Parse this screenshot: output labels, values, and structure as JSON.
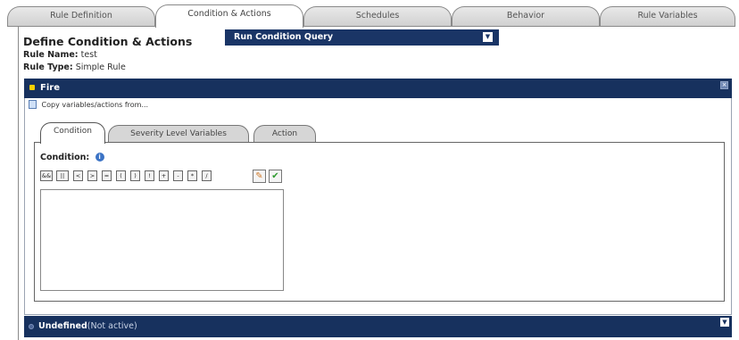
{
  "top_tabs": [
    {
      "label": "Rule Definition"
    },
    {
      "label": "Condition & Actions"
    },
    {
      "label": "Schedules"
    },
    {
      "label": "Behavior"
    },
    {
      "label": "Rule Variables"
    }
  ],
  "active_top_tab": "Condition & Actions",
  "page": {
    "title": "Define Condition & Actions",
    "rule_name_label": "Rule Name:",
    "rule_name_value": "test",
    "rule_type_label": "Rule Type:",
    "rule_type_value": "Simple Rule"
  },
  "run_query": {
    "label": "Run Condition Query",
    "icon": "chevron-down-icon"
  },
  "fire": {
    "title": "Fire",
    "copy_link": "Copy variables/actions from...",
    "inner_tabs": [
      {
        "label": "Condition"
      },
      {
        "label": "Severity Level Variables"
      },
      {
        "label": "Action"
      }
    ],
    "active_inner_tab": "Condition",
    "condition_label": "Condition:",
    "operators": [
      "&&",
      "||",
      "<",
      ">",
      "=",
      "(",
      ")",
      "!",
      "+",
      "-",
      "*",
      "/"
    ],
    "condition_value": ""
  },
  "undefined_section": {
    "title": "Undefined",
    "subtitle": "(Not active)"
  },
  "colors": {
    "header_bar": "#17315e",
    "run_query_bg": "#1a3566",
    "fire_bullet": "#f5d000"
  }
}
